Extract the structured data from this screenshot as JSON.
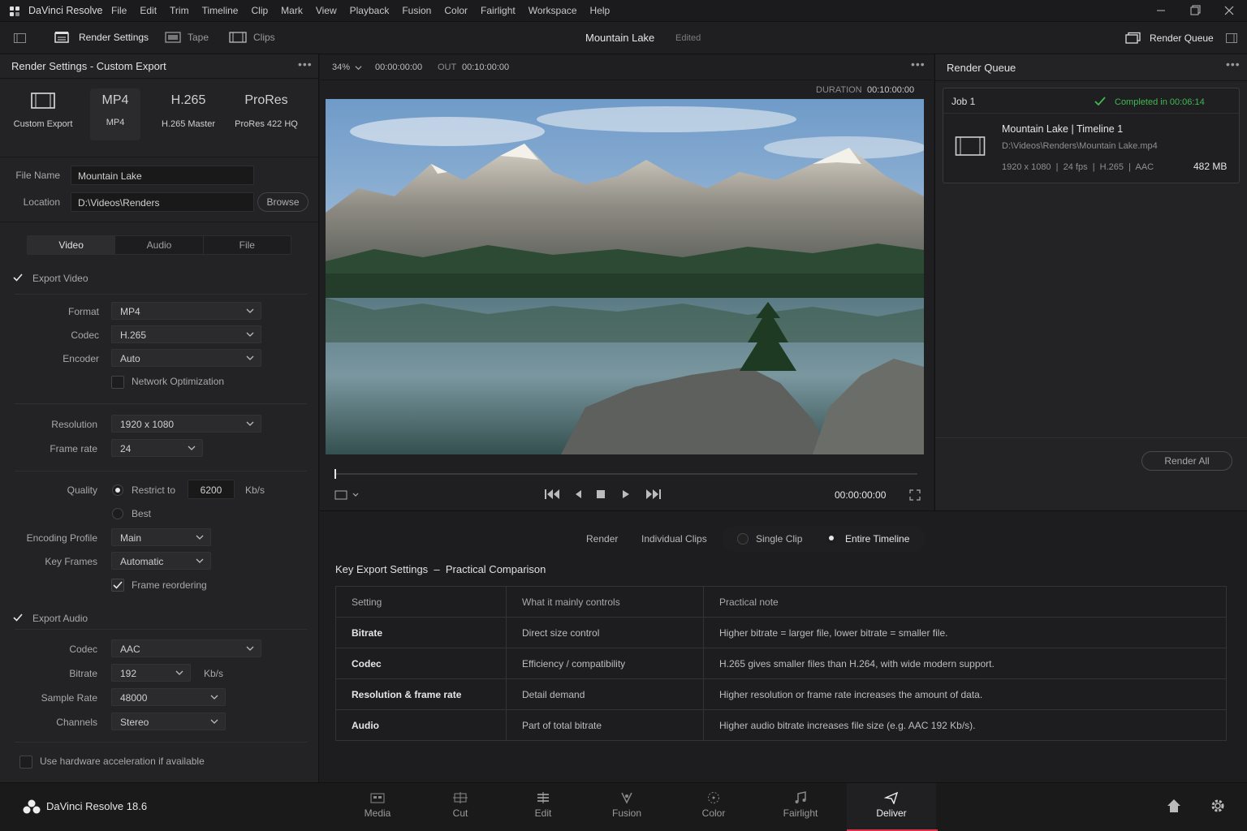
{
  "app": {
    "name": "DaVinci Resolve"
  },
  "menu": [
    "File",
    "Edit",
    "Trim",
    "Timeline",
    "Clip",
    "Mark",
    "View",
    "Playback",
    "Fusion",
    "Color",
    "Fairlight",
    "Workspace",
    "Help"
  ],
  "toolbar": {
    "render_settings": "Render Settings",
    "tape": "Tape",
    "clips": "Clips",
    "project_title": "Mountain Lake",
    "status": "Edited",
    "render_queue": "Render Queue"
  },
  "left": {
    "title": "Render Settings - Custom Export",
    "presets": [
      {
        "big": "",
        "label": "Custom Export",
        "icon": "film-frame-icon"
      },
      {
        "big": "MP4",
        "label": "MP4"
      },
      {
        "big": "H.265",
        "label": "H.265 Master"
      },
      {
        "big": "ProRes",
        "label": "ProRes 422 HQ"
      }
    ],
    "file_name_label": "File Name",
    "file_name": "Mountain Lake",
    "location_label": "Location",
    "location": "D:\\Videos\\Renders",
    "browse": "Browse",
    "tabs": [
      "Video",
      "Audio",
      "File"
    ],
    "export_video": "Export Video",
    "format_label": "Format",
    "format": "MP4",
    "codec_label": "Codec",
    "codec": "H.265",
    "encoder_label": "Encoder",
    "encoder": "Auto",
    "network_opt": "Network Optimization",
    "resolution_label": "Resolution",
    "resolution": "1920 x 1080",
    "framerate_label": "Frame rate",
    "framerate": "24",
    "quality_label": "Quality",
    "restrict_to": "Restrict to",
    "bitrate_value": "6200",
    "kbs": "Kb/s",
    "best": "Best",
    "encoding_profile_label": "Encoding Profile",
    "encoding_profile": "Main",
    "key_frames_label": "Key Frames",
    "key_frames": "Automatic",
    "frame_reordering": "Frame reordering",
    "export_audio": "Export Audio",
    "a_codec_label": "Codec",
    "a_codec": "AAC",
    "a_bitrate_label": "Bitrate",
    "a_bitrate": "192",
    "a_kbs": "Kb/s",
    "sample_rate_label": "Sample Rate",
    "sample_rate": "48000",
    "channels_label": "Channels",
    "channels": "Stereo",
    "hw_accel": "Use hardware acceleration if available"
  },
  "viewer": {
    "zoom": "34%",
    "in_tc": "00:00:00:00",
    "out_label": "OUT",
    "out_tc": "00:10:00:00",
    "duration_label": "DURATION",
    "duration": "00:10:00:00",
    "playhead_tc": "00:00:00:00",
    "playhead_position": 0.0
  },
  "queue": {
    "title": "Render Queue",
    "job": "Job 1",
    "status": "Completed in 00:06:14",
    "clip_title": "Mountain Lake | Timeline 1",
    "path": "D:\\Videos\\Renders\\Mountain Lake.mp4",
    "meta": "1920 x 1080  |  24 fps  |  H.265  |  AAC",
    "size": "482 MB",
    "render_all": "Render All"
  },
  "render_mode": {
    "render": "Render",
    "individual": "Individual Clips",
    "single": "Single Clip",
    "entire": "Entire Timeline",
    "selected": "Entire Timeline"
  },
  "comparison": {
    "title": "Key Export Settings  –  Practical Comparison",
    "headers": [
      "Setting",
      "What it mainly controls",
      "Practical note"
    ],
    "rows": [
      [
        "Bitrate",
        "Direct size control",
        "Higher bitrate = larger file, lower bitrate = smaller file."
      ],
      [
        "Codec",
        "Efficiency / compatibility",
        "H.265 gives smaller files than H.264, with wide modern support."
      ],
      [
        "Resolution & frame rate",
        "Detail demand",
        "Higher resolution or frame rate increases the amount of data."
      ],
      [
        "Audio",
        "Part of total bitrate",
        "Higher audio bitrate increases file size (e.g. AAC 192 Kb/s)."
      ]
    ]
  },
  "bottom": {
    "version": "DaVinci Resolve 18.6",
    "pages": [
      "Media",
      "Cut",
      "Edit",
      "Fusion",
      "Color",
      "Fairlight",
      "Deliver"
    ],
    "active_page": "Deliver"
  },
  "colors": {
    "accent": "#e0304a",
    "success": "#3fb950"
  }
}
